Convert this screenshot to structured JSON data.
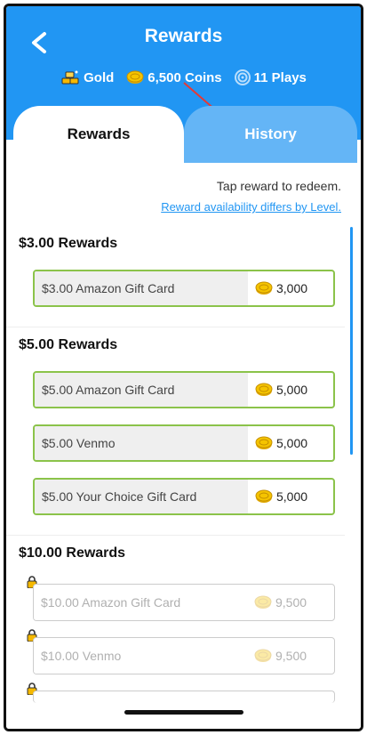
{
  "header": {
    "title": "Rewards",
    "stats": {
      "gold_label": "Gold",
      "coins_label": "6,500 Coins",
      "plays_label": "11 Plays"
    }
  },
  "tabs": [
    {
      "label": "Rewards",
      "active": true
    },
    {
      "label": "History",
      "active": false
    }
  ],
  "hint": "Tap reward to redeem.",
  "availability_link": "Reward availability differs by Level.",
  "sections": [
    {
      "title": "$3.00 Rewards",
      "items": [
        {
          "label": "$3.00 Amazon Gift Card",
          "cost": "3,000",
          "locked": false
        }
      ]
    },
    {
      "title": "$5.00 Rewards",
      "items": [
        {
          "label": "$5.00 Amazon Gift Card",
          "cost": "5,000",
          "locked": false
        },
        {
          "label": "$5.00 Venmo",
          "cost": "5,000",
          "locked": false
        },
        {
          "label": "$5.00 Your Choice Gift Card",
          "cost": "5,000",
          "locked": false
        }
      ]
    },
    {
      "title": "$10.00 Rewards",
      "items": [
        {
          "label": "$10.00 Amazon Gift Card",
          "cost": "9,500",
          "locked": true
        },
        {
          "label": "$10.00 Venmo",
          "cost": "9,500",
          "locked": true
        }
      ]
    }
  ],
  "colors": {
    "header_blue": "#2196f3",
    "inactive_tab_blue": "#64b5f6",
    "card_border_green": "#8bc34a",
    "coin_gold": "#f5b800",
    "annotation_arrow_red": "#e53935"
  },
  "icons": [
    "back-arrow-icon",
    "gold-icon",
    "coin-icon",
    "plays-swirl-icon",
    "lock-icon"
  ]
}
